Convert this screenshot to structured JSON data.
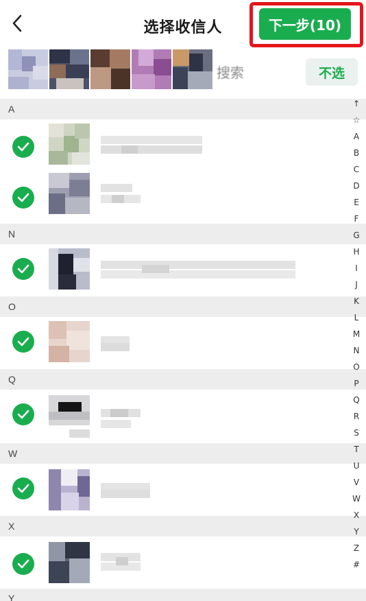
{
  "header": {
    "title": "选择收信人",
    "next_button_label": "下一步(10)"
  },
  "selected_bar": {
    "search_placeholder": "搜索",
    "deselect_label": "不选"
  },
  "sections": [
    {
      "letter": "A"
    },
    {
      "letter": "N"
    },
    {
      "letter": "O"
    },
    {
      "letter": "Q"
    },
    {
      "letter": "W"
    },
    {
      "letter": "X"
    },
    {
      "letter": "Y"
    }
  ],
  "index_bar": {
    "letters": [
      "↑",
      "☆",
      "A",
      "B",
      "C",
      "D",
      "E",
      "F",
      "G",
      "H",
      "I",
      "J",
      "K",
      "L",
      "M",
      "N",
      "O",
      "P",
      "Q",
      "R",
      "S",
      "T",
      "U",
      "V",
      "W",
      "X",
      "Y",
      "Z",
      "#"
    ]
  },
  "colors": {
    "accent": "#1aad4f",
    "highlight": "#e4161c",
    "section_bg": "#ededed"
  }
}
